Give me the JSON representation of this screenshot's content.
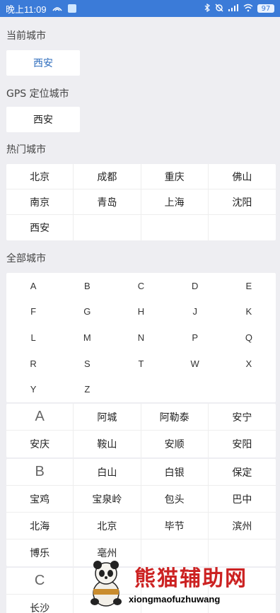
{
  "status": {
    "time": "晚上11:09",
    "battery": "97",
    "net_icon": "signal-icon"
  },
  "sections": {
    "current": "当前城市",
    "gps": "GPS 定位城市",
    "hot": "热门城市",
    "all": "全部城市"
  },
  "current_city": "西安",
  "gps_city": "西安",
  "hot_cities": [
    "北京",
    "成都",
    "重庆",
    "佛山",
    "南京",
    "青岛",
    "上海",
    "沈阳",
    "西安",
    "",
    "",
    ""
  ],
  "alphabet": [
    "A",
    "B",
    "C",
    "D",
    "E",
    "F",
    "G",
    "H",
    "J",
    "K",
    "L",
    "M",
    "N",
    "P",
    "Q",
    "R",
    "S",
    "T",
    "W",
    "X",
    "Y",
    "Z",
    "",
    "",
    ""
  ],
  "groups": [
    {
      "letter": "A",
      "rows": [
        [
          "A",
          "阿城",
          "阿勒泰",
          "安宁"
        ],
        [
          "安庆",
          "鞍山",
          "安顺",
          "安阳"
        ]
      ]
    },
    {
      "letter": "B",
      "rows": [
        [
          "B",
          "白山",
          "白银",
          "保定"
        ],
        [
          "宝鸡",
          "宝泉岭",
          "包头",
          "巴中"
        ],
        [
          "北海",
          "北京",
          "毕节",
          "滨州"
        ],
        [
          "博乐",
          "亳州",
          "",
          ""
        ]
      ]
    },
    {
      "letter": "C",
      "rows": [
        [
          "C",
          "",
          "",
          ""
        ],
        [
          "长沙",
          "",
          "",
          ""
        ]
      ]
    }
  ],
  "watermark": {
    "cn": "熊猫辅助网",
    "en": "xiongmaofuzhuwang"
  },
  "colors": {
    "status_bg": "#3b7bd8",
    "accent": "#2e6dbd",
    "page_bg": "#eeeef2"
  }
}
